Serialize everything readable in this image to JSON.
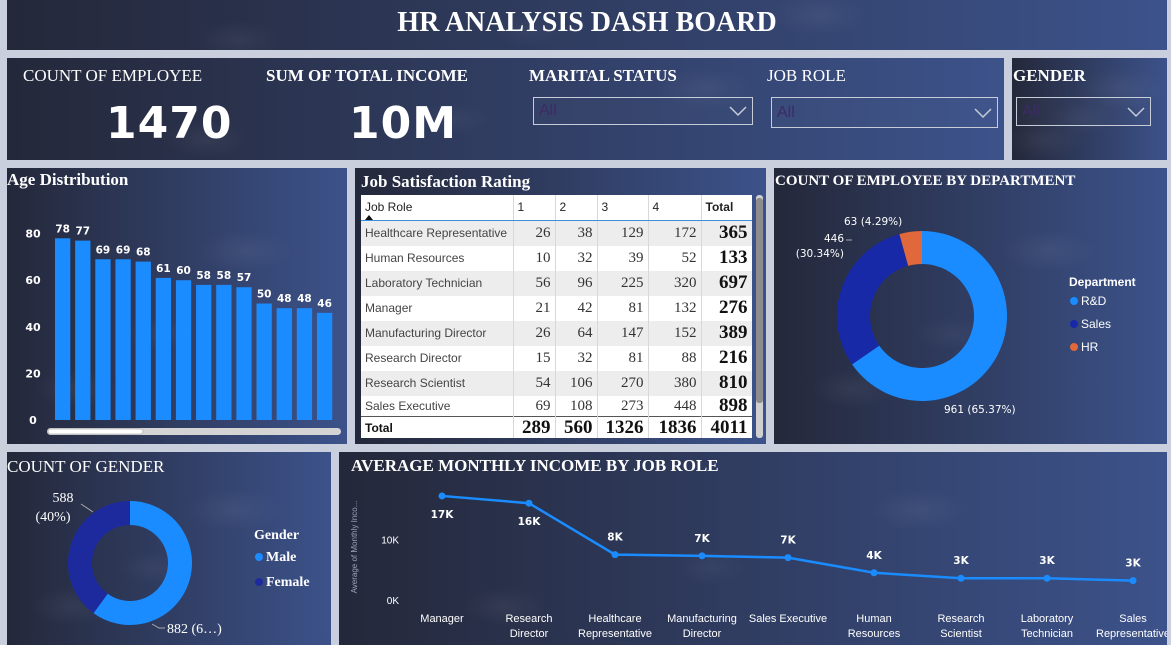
{
  "title": "HR ANALYSIS DASH BOARD",
  "kpis": {
    "count_label": "COUNT OF EMPLOYEE",
    "count_value": "1470",
    "income_label": "SUM OF TOTAL INCOME",
    "income_value": "10M"
  },
  "slicers": {
    "marital": {
      "label": "MARITAL STATUS",
      "value": "All"
    },
    "job_role": {
      "label": "JOB ROLE",
      "value": "All"
    },
    "gender": {
      "label": "GENDER",
      "value": "All"
    }
  },
  "colors": {
    "bar": "#1a8cff",
    "rd": "#1a8cff",
    "sales": "#1729a6",
    "hr": "#e0683a",
    "male": "#1a8cff",
    "female": "#1d2a9e",
    "line": "#1a8cff"
  },
  "age_panel": {
    "title": "Age Distribution"
  },
  "jobsat_panel": {
    "title": "Job Satisfaction Rating",
    "headers": [
      "Job Role",
      "1",
      "2",
      "3",
      "4",
      "Total"
    ],
    "rows": [
      [
        "Healthcare Representative",
        "26",
        "38",
        "129",
        "172",
        "365"
      ],
      [
        "Human Resources",
        "10",
        "32",
        "39",
        "52",
        "133"
      ],
      [
        "Laboratory Technician",
        "56",
        "96",
        "225",
        "320",
        "697"
      ],
      [
        "Manager",
        "21",
        "42",
        "81",
        "132",
        "276"
      ],
      [
        "Manufacturing Director",
        "26",
        "64",
        "147",
        "152",
        "389"
      ],
      [
        "Research Director",
        "15",
        "32",
        "81",
        "88",
        "216"
      ],
      [
        "Research Scientist",
        "54",
        "106",
        "270",
        "380",
        "810"
      ],
      [
        "Sales Executive",
        "69",
        "108",
        "273",
        "448",
        "898"
      ]
    ],
    "total_row": [
      "Total",
      "289",
      "560",
      "1326",
      "1836",
      "4011"
    ]
  },
  "dept_panel": {
    "title": "COUNT OF EMPLOYEE BY DEPARTMENT",
    "legend_title": "Department",
    "legend": [
      "R&D",
      "Sales",
      "HR"
    ],
    "labels": {
      "rd": "961 (65.37%)",
      "sales_count": "446",
      "sales_pct": "(30.34%)",
      "hr": "63 (4.29%)"
    }
  },
  "gender_panel": {
    "title": "COUNT OF GENDER",
    "legend_title": "Gender",
    "legend": [
      "Male",
      "Female"
    ],
    "labels": {
      "female_count": "588",
      "female_pct": "(40%)",
      "male": "882 (6…)"
    }
  },
  "income_panel": {
    "title": "AVERAGE MONTHLY INCOME BY JOB ROLE",
    "ylabel": "Average of Monthly Inco..."
  },
  "chart_data": [
    {
      "type": "bar",
      "title": "Age Distribution",
      "values": [
        78,
        77,
        69,
        69,
        68,
        61,
        60,
        58,
        58,
        57,
        50,
        48,
        48,
        46
      ],
      "data_labels": [
        "78",
        "77",
        "69",
        "69",
        "68",
        "61",
        "60",
        "58",
        "58",
        "57",
        "50",
        "48",
        "48",
        "46"
      ],
      "yticks": [
        "0",
        "20",
        "40",
        "60",
        "80"
      ],
      "ylim": [
        0,
        88
      ]
    },
    {
      "type": "pie",
      "title": "COUNT OF EMPLOYEE BY DEPARTMENT",
      "categories": [
        "R&D",
        "Sales",
        "HR"
      ],
      "values": [
        961,
        446,
        63
      ]
    },
    {
      "type": "pie",
      "title": "COUNT OF GENDER",
      "categories": [
        "Male",
        "Female"
      ],
      "values": [
        882,
        588
      ]
    },
    {
      "type": "line",
      "title": "AVERAGE MONTHLY INCOME BY JOB ROLE",
      "ylabel": "Average of Monthly Inco...",
      "categories": [
        [
          "Manager"
        ],
        [
          "Research",
          "Director"
        ],
        [
          "Healthcare",
          "Representative"
        ],
        [
          "Manufacturing",
          "Director"
        ],
        [
          "Sales Executive"
        ],
        [
          "Human",
          "Resources"
        ],
        [
          "Research",
          "Scientist"
        ],
        [
          "Laboratory",
          "Technician"
        ],
        [
          "Sales",
          "Representative"
        ]
      ],
      "values": [
        17200,
        16000,
        7500,
        7300,
        7000,
        4500,
        3600,
        3600,
        3200
      ],
      "data_labels": [
        "17K",
        "16K",
        "8K",
        "7K",
        "7K",
        "4K",
        "3K",
        "3K",
        "3K"
      ],
      "yticks": [
        "0K",
        "10K"
      ],
      "ylim": [
        0,
        20000
      ]
    }
  ]
}
